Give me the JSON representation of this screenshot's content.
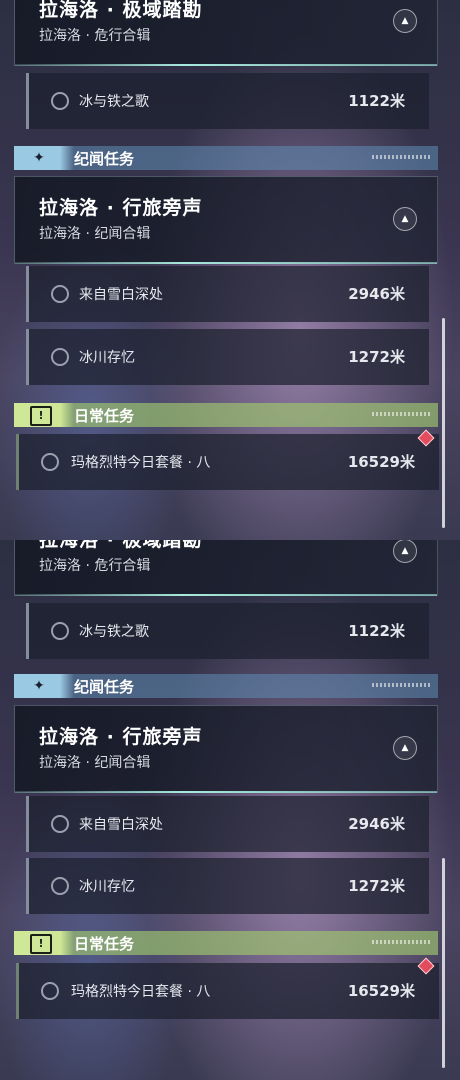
{
  "views": [
    {
      "category_top": {
        "title": "拉海洛 · 极域踏勘",
        "subtitle": "拉海洛 · 危行合辑",
        "expand_icon": "chevron-up-icon"
      },
      "top_tasks": [
        {
          "name": "冰与铁之歌",
          "distance": "1122米"
        }
      ],
      "sections": [
        {
          "label": "纪闻任务",
          "icon": "sparkle-icon",
          "color": "#a0d2eb",
          "group": {
            "title": "拉海洛 · 行旅旁声",
            "subtitle": "拉海洛 · 纪闻合辑",
            "expand_icon": "chevron-up-icon"
          },
          "tasks": [
            {
              "name": "来自雪白深处",
              "distance": "2946米"
            },
            {
              "name": "冰川存忆",
              "distance": "1272米"
            }
          ]
        },
        {
          "label": "日常任务",
          "icon": "exclamation-icon",
          "color": "#cfe897",
          "tasks": [
            {
              "name": "玛格烈特今日套餐 · 八",
              "distance": "16529米",
              "marker": "new-marker-diamond"
            }
          ]
        }
      ]
    },
    {
      "category_top": {
        "title": "拉海洛 · 极域踏勘",
        "subtitle": "拉海洛 · 危行合辑",
        "expand_icon": "chevron-up-icon"
      },
      "top_tasks": [
        {
          "name": "冰与铁之歌",
          "distance": "1122米"
        }
      ],
      "sections": [
        {
          "label": "纪闻任务",
          "icon": "sparkle-icon",
          "color": "#a0d2eb",
          "group": {
            "title": "拉海洛 · 行旅旁声",
            "subtitle": "拉海洛 · 纪闻合辑",
            "expand_icon": "chevron-up-icon"
          },
          "tasks": [
            {
              "name": "来自雪白深处",
              "distance": "2946米"
            },
            {
              "name": "冰川存忆",
              "distance": "1272米"
            }
          ]
        },
        {
          "label": "日常任务",
          "icon": "exclamation-icon",
          "color": "#cfe897",
          "tasks": [
            {
              "name": "玛格烈特今日套餐 · 八",
              "distance": "16529米",
              "marker": "new-marker-diamond"
            }
          ]
        }
      ]
    }
  ]
}
